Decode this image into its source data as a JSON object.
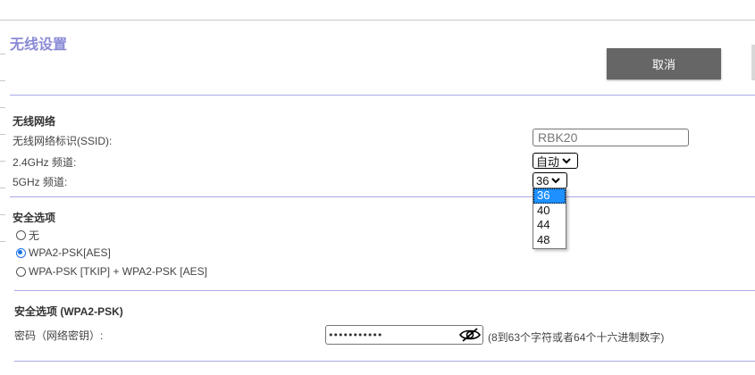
{
  "page": {
    "title": "无线设置",
    "cancel_label": "取消"
  },
  "wireless": {
    "section_title": "无线网络",
    "ssid_label": "无线网络标识(SSID):",
    "ssid_value": "RBK20",
    "band24_label": "2.4GHz 频道:",
    "band24_value": "自动",
    "band5_label": "5GHz 频道:",
    "band5_value": "36",
    "band5_options": [
      "36",
      "40",
      "44",
      "48"
    ]
  },
  "security": {
    "section_title": "安全选项",
    "options": [
      {
        "label": "无",
        "checked": false
      },
      {
        "label": "WPA2-PSK[AES]",
        "checked": true
      },
      {
        "label": "WPA-PSK [TKIP] + WPA2-PSK [AES]",
        "checked": false
      }
    ]
  },
  "wpa": {
    "section_title": "安全选项 (WPA2-PSK)",
    "password_label": "密码（网络密钥）:",
    "password_masked": "•••••••••••",
    "hint": "(8到63个字符或者64个十六进制数字)",
    "toggle_icon": "eye-slash-icon"
  },
  "colors": {
    "title": "#8a8ad6",
    "rule": "#a9a9e6",
    "button": "#666666",
    "highlight": "#1e90ff"
  }
}
